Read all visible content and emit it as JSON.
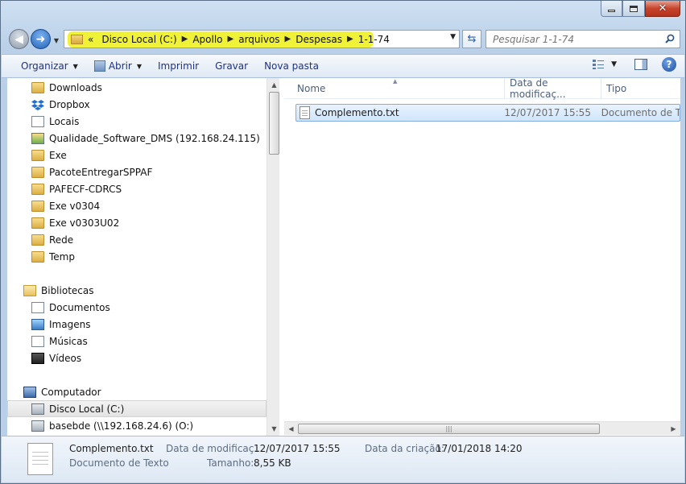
{
  "address": {
    "overflow": "«",
    "crumbs": [
      "Disco Local (C:)",
      "Apollo",
      "arquivos",
      "Despesas",
      "1-1-74"
    ]
  },
  "search": {
    "placeholder": "Pesquisar 1-1-74"
  },
  "toolbar": {
    "organize": "Organizar",
    "open": "Abrir",
    "print": "Imprimir",
    "burn": "Gravar",
    "new_folder": "Nova pasta"
  },
  "nav": {
    "favorites": [
      "Downloads",
      "Dropbox",
      "Locais",
      "Qualidade_Software_DMS (192.168.24.115)",
      "Exe",
      "PacoteEntregarSPPAF",
      "PAFECF-CDRCS",
      "Exe v0304",
      "Exe v0303U02",
      "Rede",
      "Temp"
    ],
    "libraries": {
      "label": "Bibliotecas",
      "items": [
        "Documentos",
        "Imagens",
        "Músicas",
        "Vídeos"
      ]
    },
    "computer": {
      "label": "Computador",
      "items": [
        "Disco Local (C:)",
        "basebde (\\\\192.168.24.6) (O:)"
      ]
    }
  },
  "columns": {
    "name": "Nome",
    "date": "Data de modificaç...",
    "type": "Tipo"
  },
  "files": [
    {
      "name": "Complemento.txt",
      "modified": "12/07/2017 15:55",
      "type": "Documento de Texto"
    }
  ],
  "details": {
    "filename": "Complemento.txt",
    "filetype": "Documento de Texto",
    "modified_label": "Data de modificaç...",
    "modified_value": "12/07/2017 15:55",
    "created_label": "Data da criação:",
    "created_value": "17/01/2018 14:20",
    "size_label": "Tamanho:",
    "size_value": "8,55 KB"
  },
  "colors": {
    "address_highlight": "#f0f238",
    "selection": "#cfe5fb",
    "link_text": "#1e3287"
  }
}
